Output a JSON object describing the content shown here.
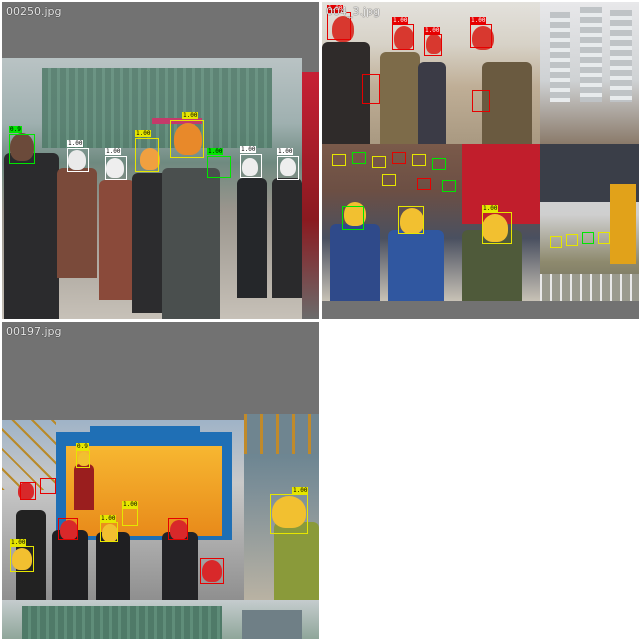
{
  "tiles": [
    {
      "filename": "00250.jpg"
    },
    {
      "filename": "004_3.jpg"
    },
    {
      "filename": "00197.jpg"
    }
  ],
  "colors": {
    "background": "#ffffff",
    "padding_gray": "#727272",
    "helmet_box": "#e6e600",
    "head_box": "#e60000",
    "green_box": "#00e600",
    "white_box": "#ffffff"
  },
  "detections": {
    "helmet_tag": "1.00",
    "head_tag": "1.00",
    "alt_tag": "0.9"
  }
}
